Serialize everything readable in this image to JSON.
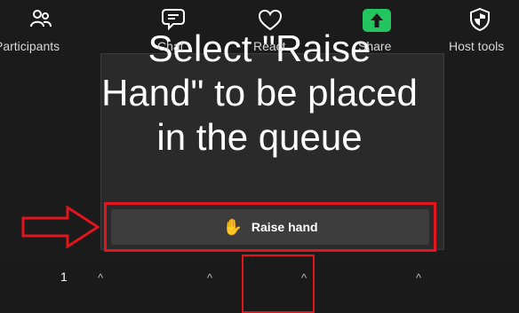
{
  "caption": "Select \"Raise\nHand\" to be placed\nin the queue",
  "reactions_popup": {
    "raise_hand_label": "Raise hand",
    "raise_hand_icon": "hand-icon"
  },
  "toolbar": {
    "participants": {
      "label": "Participants",
      "count": "1",
      "icon": "participants-icon"
    },
    "chat": {
      "label": "Chat",
      "icon": "chat-icon"
    },
    "react": {
      "label": "React",
      "icon": "heart-icon"
    },
    "share": {
      "label": "Share",
      "icon": "share-arrow-icon"
    },
    "host_tools": {
      "label": "Host tools",
      "icon": "shield-icon"
    }
  },
  "colors": {
    "background": "#1b1b1b",
    "highlight": "#e2141c",
    "share_green": "#22c55e",
    "hand_yellow": "#f7c22c"
  }
}
